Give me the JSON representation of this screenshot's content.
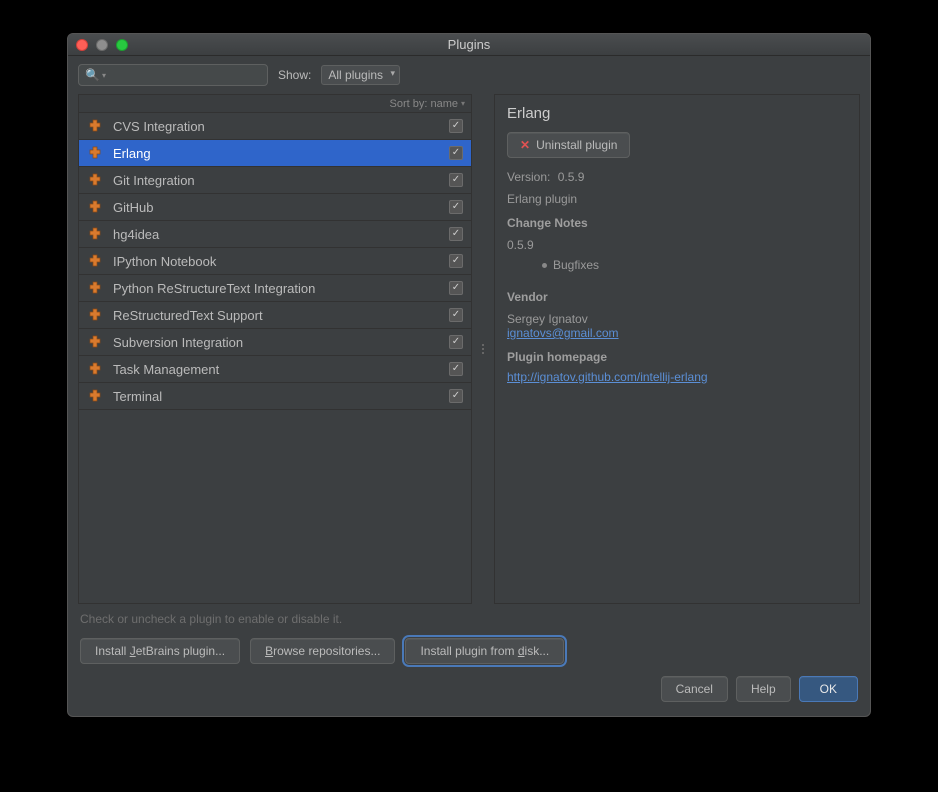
{
  "window": {
    "title": "Plugins"
  },
  "toolbar": {
    "show_label": "Show:",
    "show_value": "All plugins"
  },
  "sort": {
    "label": "Sort by:",
    "value": "name"
  },
  "plugins": [
    {
      "name": "CVS Integration",
      "checked": true,
      "selected": false
    },
    {
      "name": "Erlang",
      "checked": true,
      "selected": true
    },
    {
      "name": "Git Integration",
      "checked": true,
      "selected": false
    },
    {
      "name": "GitHub",
      "checked": true,
      "selected": false
    },
    {
      "name": "hg4idea",
      "checked": true,
      "selected": false
    },
    {
      "name": "IPython Notebook",
      "checked": true,
      "selected": false
    },
    {
      "name": "Python ReStructureText Integration",
      "checked": true,
      "selected": false
    },
    {
      "name": "ReStructuredText Support",
      "checked": true,
      "selected": false
    },
    {
      "name": "Subversion Integration",
      "checked": true,
      "selected": false
    },
    {
      "name": "Task Management",
      "checked": true,
      "selected": false
    },
    {
      "name": "Terminal",
      "checked": true,
      "selected": false
    }
  ],
  "detail": {
    "title": "Erlang",
    "uninstall_label": "Uninstall plugin",
    "version_label": "Version:",
    "version_value": "0.5.9",
    "description": "Erlang plugin",
    "change_notes_head": "Change Notes",
    "change_notes_version": "0.5.9",
    "change_notes_bullet": "Bugfixes",
    "vendor_head": "Vendor",
    "vendor_name": "Sergey Ignatov",
    "vendor_email": "ignatovs@gmail.com",
    "homepage_head": "Plugin homepage",
    "homepage_url": "http://ignatov.github.com/intellij-erlang"
  },
  "hint": "Check or uncheck a plugin to enable or disable it.",
  "footer": {
    "install_jetbrains": "Install JetBrains plugin...",
    "browse_repos": "Browse repositories...",
    "install_disk": "Install plugin from disk..."
  },
  "dialog": {
    "cancel": "Cancel",
    "help": "Help",
    "ok": "OK"
  }
}
